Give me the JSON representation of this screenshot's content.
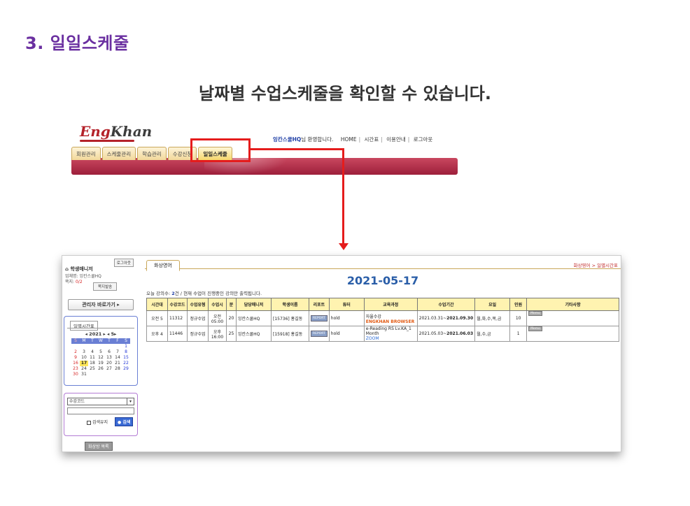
{
  "heading": "3. 일일스케줄",
  "subtitle": "날짜별 수업스케줄을 확인할 수 있습니다.",
  "colors": {
    "accent": "#6a2fa0",
    "highlight": "#e51c1c",
    "navbar": "#9d1f3b",
    "table_header": "#fff3b0"
  },
  "banner": {
    "logo": {
      "part1": "Eng",
      "part2": "Khan"
    },
    "welcome": {
      "org": "잉칸스쿨HQ",
      "greeting": "님 환영합니다."
    },
    "links": [
      "HOME",
      "시간표",
      "이용안내",
      "로그아웃"
    ],
    "tabs": [
      "회원관리",
      "스케줄관리",
      "학습관리",
      "수강신청",
      "일일스케줄"
    ],
    "active_tab": "일일스케줄"
  },
  "left": {
    "logout": "로그아웃",
    "name": "학생매니저",
    "branch_label": "업체명:",
    "branch": "잉칸스쿨HQ",
    "note_label": "쪽지:",
    "note_count": "0/2",
    "note_btn": "쪽지발송",
    "admin_btn": "관리자 바로가기 ▸",
    "calendar": {
      "tab": "일별시간표",
      "nav": "◂ 2021 ▸   ◂ 5▸",
      "weekdays": [
        "S",
        "M",
        "T",
        "W",
        "T",
        "F",
        "S"
      ],
      "weeks": [
        [
          "",
          "",
          "",
          "",
          "",
          "",
          "1"
        ],
        [
          "2",
          "3",
          "4",
          "5",
          "6",
          "7",
          "8"
        ],
        [
          "9",
          "10",
          "11",
          "12",
          "13",
          "14",
          "15"
        ],
        [
          "16",
          "17",
          "18",
          "19",
          "20",
          "21",
          "22"
        ],
        [
          "23",
          "24",
          "25",
          "26",
          "27",
          "28",
          "29"
        ],
        [
          "30",
          "31",
          "",
          "",
          "",
          "",
          ""
        ]
      ],
      "today": "17"
    },
    "search": {
      "select": "수강코드",
      "keep": "검색유지",
      "button": "검색"
    },
    "home_list": "화상방 목록"
  },
  "right": {
    "tab": "화상영어",
    "breadcrumb": "화상영어 > 일별시간표",
    "date": "2021-05-17",
    "summary": {
      "prefix": "오늘 강의수:",
      "count": "2",
      "suffix": "건 / 현재 수업이 진행중인 강의만 출력됩니다."
    },
    "columns": [
      "시간대",
      "수강코드",
      "수업유형",
      "수업시",
      "분",
      "담당매니저",
      "학생이름",
      "리포트",
      "튜터",
      "교육과정",
      "수업기간",
      "요일",
      "인원",
      "기타사항"
    ],
    "rows": [
      {
        "slot": "오전 5",
        "code": "11312",
        "type": "정규수업",
        "time": "오전 05:00",
        "min": "20",
        "manager": "잉칸스쿨HQ",
        "student": "[15736] 홍길동",
        "report": "REPORT",
        "tutor": "hold",
        "course1": "자율수강",
        "course2": "ENGKHAN BROWSER",
        "period_start": "2021.03.31~",
        "period_end": "2021.09.30",
        "days": "월,화,수,목,금",
        "count": "10",
        "memo": "Memo"
      },
      {
        "slot": "오후 4",
        "code": "11446",
        "type": "정규수업",
        "time": "오후 16:00",
        "min": "25",
        "manager": "잉칸스쿨HQ",
        "student": "[15918] 홍길동",
        "report": "REPORT",
        "tutor": "hold",
        "course1": "e-Reading RS Lv.KA_1 Month",
        "course2": "ZOOM",
        "period_start": "2021.05.03~",
        "period_end": "2021.06.03",
        "days": "월,수,금",
        "count": "1",
        "memo": "Memo"
      }
    ]
  }
}
